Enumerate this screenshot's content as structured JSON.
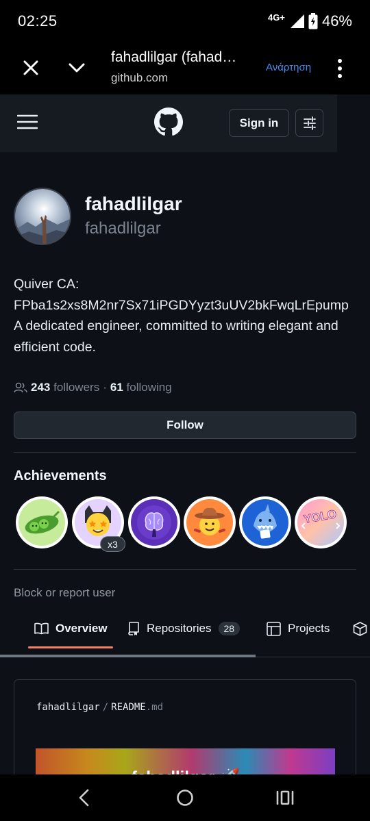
{
  "status_bar": {
    "time": "02:25",
    "network": "4G+",
    "battery": "46%"
  },
  "browser": {
    "title": "fahadlilgar (fahad…",
    "url": "github.com",
    "action_label": "Ανάρτηση",
    "close_icon": "close-icon",
    "chevron_icon": "chevron-down-icon",
    "menu_icon": "more-vertical-icon"
  },
  "header": {
    "sign_in_label": "Sign in",
    "logo_icon": "github-logo-icon",
    "menu_icon": "hamburger-icon",
    "filter_icon": "sliders-icon"
  },
  "profile": {
    "display_name": "fahadlilgar",
    "username": "fahadlilgar",
    "bio_lines": [
      "Quiver CA:",
      "FPba1s2xs8M2nr7Sx71iPGDYyzt3uUV2bkFwqLrEpump",
      "A dedicated engineer, committed to writing elegant and",
      "efficient code."
    ],
    "followers_count": "243",
    "followers_label": "followers",
    "separator": "·",
    "following_count": "61",
    "following_label": "following",
    "follow_label": "Follow"
  },
  "achievements": {
    "title": "Achievements",
    "badges": [
      {
        "name": "pair-extraordinaire-badge"
      },
      {
        "name": "starstruck-badge",
        "count": "x3"
      },
      {
        "name": "galaxy-brain-badge"
      },
      {
        "name": "quickdraw-badge"
      },
      {
        "name": "pull-shark-badge"
      },
      {
        "name": "yolo-badge",
        "text": "YOLO"
      }
    ]
  },
  "block_report_label": "Block or report user",
  "tabs": [
    {
      "label": "Overview",
      "icon": "book-icon",
      "active": true
    },
    {
      "label": "Repositories",
      "icon": "repo-icon",
      "count": "28"
    },
    {
      "label": "Projects",
      "icon": "table-icon"
    },
    {
      "label": "",
      "icon": "package-icon"
    }
  ],
  "readme": {
    "owner": "fahadlilgar",
    "separator": "/",
    "file": "README",
    "ext": ".md",
    "banner_text": "fahadlilgar 🚀"
  },
  "colors": {
    "accent_underline": "#f78166",
    "page_bg": "#0d1117",
    "header_bg": "#161b22",
    "link_blue": "#4b8ff0"
  }
}
